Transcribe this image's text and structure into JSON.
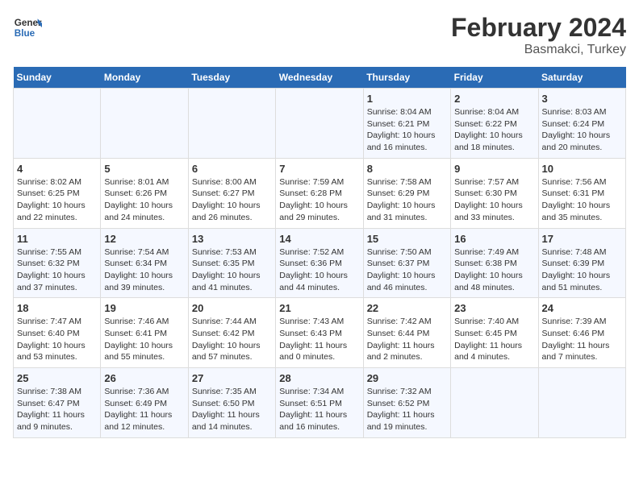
{
  "header": {
    "logo_line1": "General",
    "logo_line2": "Blue",
    "main_title": "February 2024",
    "subtitle": "Basmakci, Turkey"
  },
  "weekdays": [
    "Sunday",
    "Monday",
    "Tuesday",
    "Wednesday",
    "Thursday",
    "Friday",
    "Saturday"
  ],
  "weeks": [
    [
      {
        "day": "",
        "info": ""
      },
      {
        "day": "",
        "info": ""
      },
      {
        "day": "",
        "info": ""
      },
      {
        "day": "",
        "info": ""
      },
      {
        "day": "1",
        "info": "Sunrise: 8:04 AM\nSunset: 6:21 PM\nDaylight: 10 hours\nand 16 minutes."
      },
      {
        "day": "2",
        "info": "Sunrise: 8:04 AM\nSunset: 6:22 PM\nDaylight: 10 hours\nand 18 minutes."
      },
      {
        "day": "3",
        "info": "Sunrise: 8:03 AM\nSunset: 6:24 PM\nDaylight: 10 hours\nand 20 minutes."
      }
    ],
    [
      {
        "day": "4",
        "info": "Sunrise: 8:02 AM\nSunset: 6:25 PM\nDaylight: 10 hours\nand 22 minutes."
      },
      {
        "day": "5",
        "info": "Sunrise: 8:01 AM\nSunset: 6:26 PM\nDaylight: 10 hours\nand 24 minutes."
      },
      {
        "day": "6",
        "info": "Sunrise: 8:00 AM\nSunset: 6:27 PM\nDaylight: 10 hours\nand 26 minutes."
      },
      {
        "day": "7",
        "info": "Sunrise: 7:59 AM\nSunset: 6:28 PM\nDaylight: 10 hours\nand 29 minutes."
      },
      {
        "day": "8",
        "info": "Sunrise: 7:58 AM\nSunset: 6:29 PM\nDaylight: 10 hours\nand 31 minutes."
      },
      {
        "day": "9",
        "info": "Sunrise: 7:57 AM\nSunset: 6:30 PM\nDaylight: 10 hours\nand 33 minutes."
      },
      {
        "day": "10",
        "info": "Sunrise: 7:56 AM\nSunset: 6:31 PM\nDaylight: 10 hours\nand 35 minutes."
      }
    ],
    [
      {
        "day": "11",
        "info": "Sunrise: 7:55 AM\nSunset: 6:32 PM\nDaylight: 10 hours\nand 37 minutes."
      },
      {
        "day": "12",
        "info": "Sunrise: 7:54 AM\nSunset: 6:34 PM\nDaylight: 10 hours\nand 39 minutes."
      },
      {
        "day": "13",
        "info": "Sunrise: 7:53 AM\nSunset: 6:35 PM\nDaylight: 10 hours\nand 41 minutes."
      },
      {
        "day": "14",
        "info": "Sunrise: 7:52 AM\nSunset: 6:36 PM\nDaylight: 10 hours\nand 44 minutes."
      },
      {
        "day": "15",
        "info": "Sunrise: 7:50 AM\nSunset: 6:37 PM\nDaylight: 10 hours\nand 46 minutes."
      },
      {
        "day": "16",
        "info": "Sunrise: 7:49 AM\nSunset: 6:38 PM\nDaylight: 10 hours\nand 48 minutes."
      },
      {
        "day": "17",
        "info": "Sunrise: 7:48 AM\nSunset: 6:39 PM\nDaylight: 10 hours\nand 51 minutes."
      }
    ],
    [
      {
        "day": "18",
        "info": "Sunrise: 7:47 AM\nSunset: 6:40 PM\nDaylight: 10 hours\nand 53 minutes."
      },
      {
        "day": "19",
        "info": "Sunrise: 7:46 AM\nSunset: 6:41 PM\nDaylight: 10 hours\nand 55 minutes."
      },
      {
        "day": "20",
        "info": "Sunrise: 7:44 AM\nSunset: 6:42 PM\nDaylight: 10 hours\nand 57 minutes."
      },
      {
        "day": "21",
        "info": "Sunrise: 7:43 AM\nSunset: 6:43 PM\nDaylight: 11 hours\nand 0 minutes."
      },
      {
        "day": "22",
        "info": "Sunrise: 7:42 AM\nSunset: 6:44 PM\nDaylight: 11 hours\nand 2 minutes."
      },
      {
        "day": "23",
        "info": "Sunrise: 7:40 AM\nSunset: 6:45 PM\nDaylight: 11 hours\nand 4 minutes."
      },
      {
        "day": "24",
        "info": "Sunrise: 7:39 AM\nSunset: 6:46 PM\nDaylight: 11 hours\nand 7 minutes."
      }
    ],
    [
      {
        "day": "25",
        "info": "Sunrise: 7:38 AM\nSunset: 6:47 PM\nDaylight: 11 hours\nand 9 minutes."
      },
      {
        "day": "26",
        "info": "Sunrise: 7:36 AM\nSunset: 6:49 PM\nDaylight: 11 hours\nand 12 minutes."
      },
      {
        "day": "27",
        "info": "Sunrise: 7:35 AM\nSunset: 6:50 PM\nDaylight: 11 hours\nand 14 minutes."
      },
      {
        "day": "28",
        "info": "Sunrise: 7:34 AM\nSunset: 6:51 PM\nDaylight: 11 hours\nand 16 minutes."
      },
      {
        "day": "29",
        "info": "Sunrise: 7:32 AM\nSunset: 6:52 PM\nDaylight: 11 hours\nand 19 minutes."
      },
      {
        "day": "",
        "info": ""
      },
      {
        "day": "",
        "info": ""
      }
    ]
  ]
}
